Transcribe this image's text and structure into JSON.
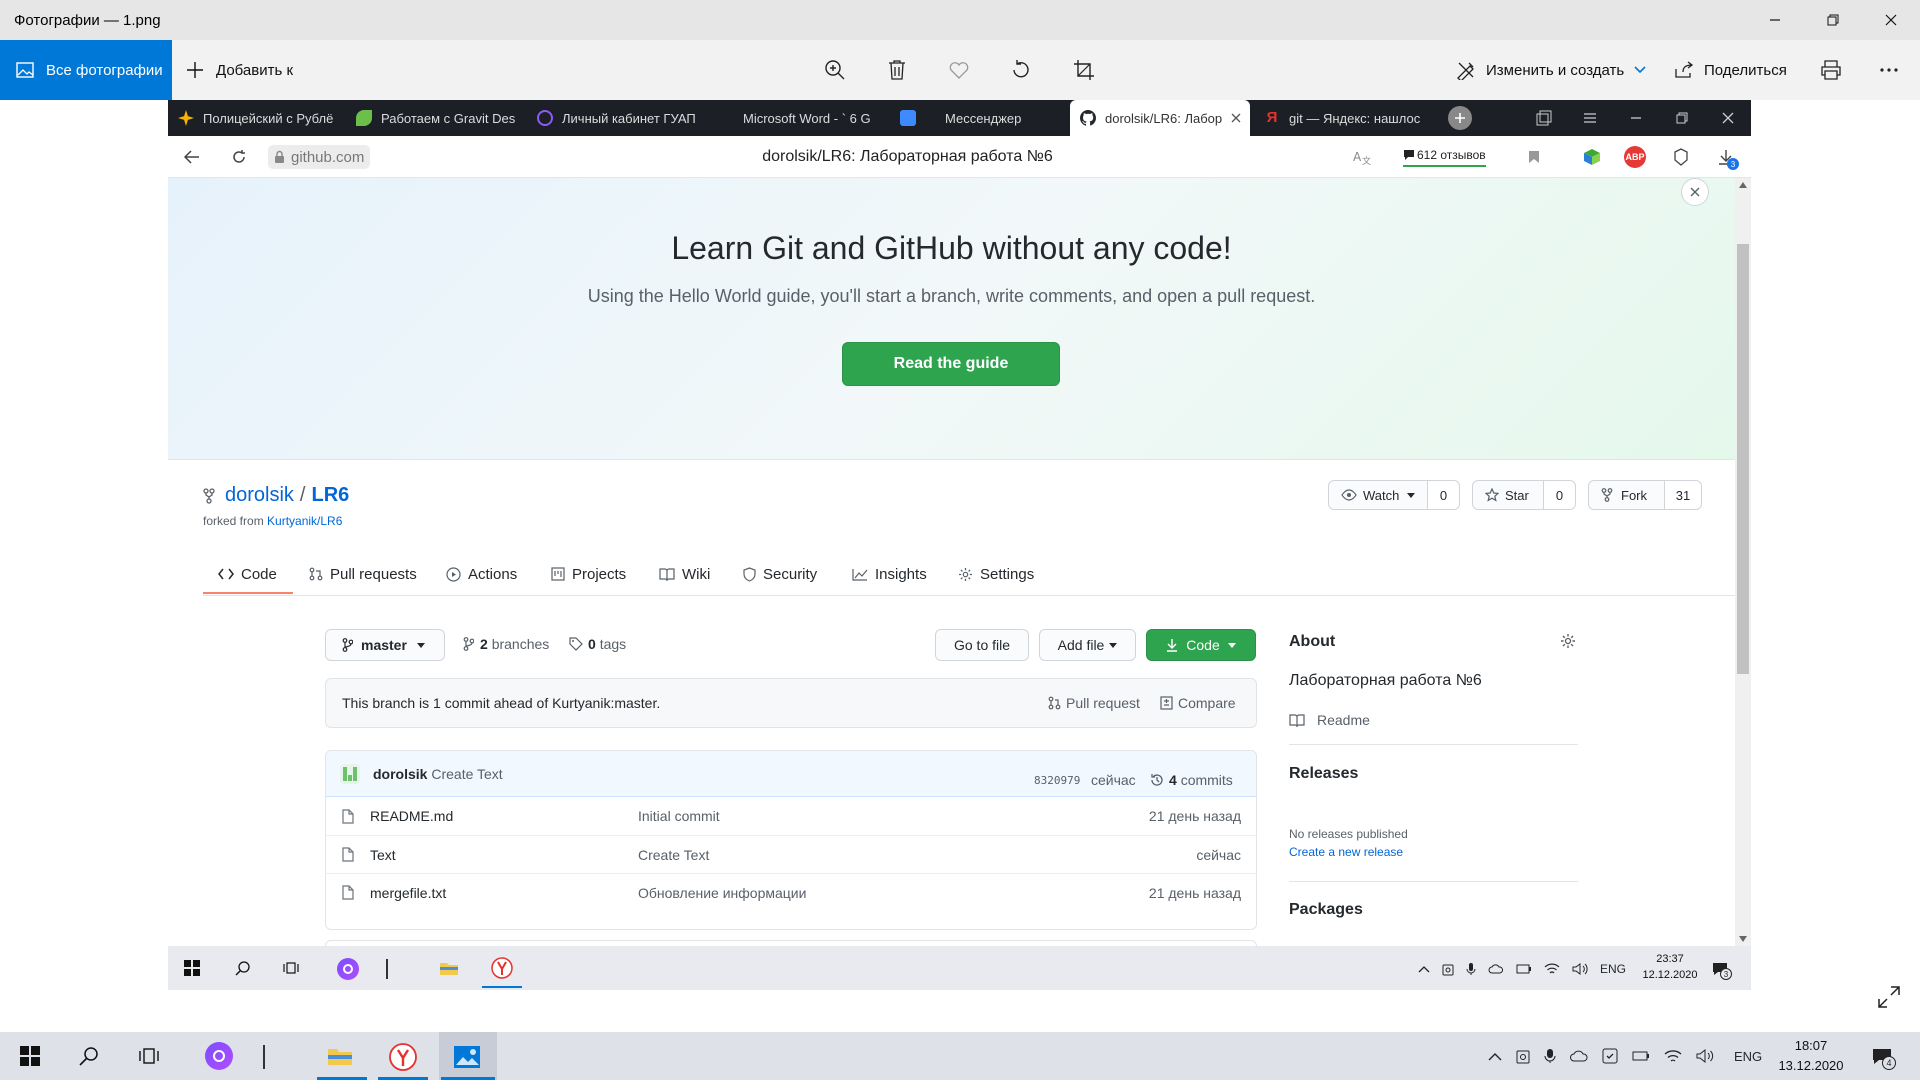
{
  "app": {
    "title": "Фотографии — 1.png"
  },
  "photos_toolbar": {
    "all_photos": "Все фотографии",
    "add_to": "Добавить к",
    "edit_create": "Изменить и создать",
    "share": "Поделиться"
  },
  "browser": {
    "tabs": [
      {
        "label": "Полицейский с Рублё",
        "color": "#f5b400"
      },
      {
        "label": "Работаем с Gravit Des",
        "color": "#6cc04a"
      },
      {
        "label": "Личный кабинет ГУАП",
        "color": "#8b5cf6"
      },
      {
        "label": "Microsoft Word - ` 6 G",
        "color": "#1c1f26"
      },
      {
        "label": "Мессенджер",
        "color": "#3d8bff"
      },
      {
        "label": "dorolsik/LR6: Лабор",
        "color": "#24292e"
      },
      {
        "label": "git — Яндекс: нашлос",
        "color": "#e5322d"
      }
    ],
    "url": "github.com",
    "page_title": "dorolsik/LR6: Лабораторная работа №6",
    "reviews": "612 отзывов",
    "downloads_badge": "3"
  },
  "banner": {
    "title": "Learn Git and GitHub without any code!",
    "subtitle": "Using the Hello World guide, you'll start a branch, write comments, and open a pull request.",
    "button": "Read the guide"
  },
  "repo": {
    "owner": "dorolsik",
    "sep": "/",
    "name": "LR6",
    "forked_label": "forked from",
    "forked_from": "Kurtyanik/LR6",
    "watch": "Watch",
    "watch_count": "0",
    "star": "Star",
    "star_count": "0",
    "fork": "Fork",
    "fork_count": "31"
  },
  "nav": [
    "Code",
    "Pull requests",
    "Actions",
    "Projects",
    "Wiki",
    "Security",
    "Insights",
    "Settings"
  ],
  "branchbar": {
    "branch": "master",
    "branches_count": "2",
    "branches_label": "branches",
    "tags_count": "0",
    "tags_label": "tags",
    "go_to_file": "Go to file",
    "add_file": "Add file",
    "code": "Code"
  },
  "ahead": {
    "text": "This branch is 1 commit ahead of Kurtyanik:master.",
    "pull_request": "Pull request",
    "compare": "Compare"
  },
  "commit": {
    "author": "dorolsik",
    "message": "Create Text",
    "sha": "8320979",
    "time": "сейчас",
    "count": "4",
    "count_label": "commits"
  },
  "files": [
    {
      "name": "README.md",
      "message": "Initial commit",
      "time": "21 день назад"
    },
    {
      "name": "Text",
      "message": "Create Text",
      "time": "сейчас"
    },
    {
      "name": "mergefile.txt",
      "message": "Обновление информации",
      "time": "21 день назад"
    }
  ],
  "about": {
    "title": "About",
    "description": "Лабораторная работа №6",
    "readme": "Readme",
    "releases_title": "Releases",
    "no_releases": "No releases published",
    "create_release": "Create a new release",
    "packages_title": "Packages"
  },
  "inner_taskbar": {
    "lang": "ENG",
    "time": "23:37",
    "date": "12.12.2020",
    "notif": "3"
  },
  "outer_taskbar": {
    "lang": "ENG",
    "time": "18:07",
    "date": "13.12.2020",
    "notif": "4"
  }
}
